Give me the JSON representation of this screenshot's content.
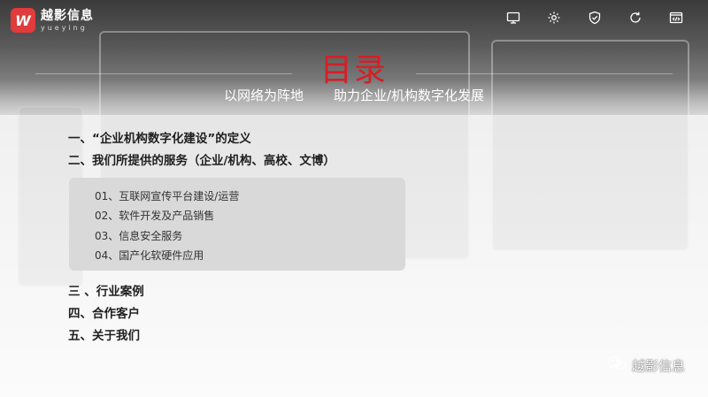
{
  "brand": {
    "logo_mark": "W",
    "name_cn": "越影信息",
    "name_en": "yueying"
  },
  "top_icons": [
    "monitor-icon",
    "settings-icon",
    "shield-icon",
    "refresh-icon",
    "code-icon"
  ],
  "header": {
    "title": "目录",
    "subtitle_left": "以网络为阵地",
    "subtitle_right": "助力企业/机构数字化发展"
  },
  "toc": {
    "items": [
      "一、“企业机构数字化建设”的定义",
      "二、我们所提供的服务（企业/机构、高校、文博）",
      "三 、行业案例",
      "四、合作客户",
      "五、关于我们"
    ],
    "sub_items": [
      "01、互联网宣传平台建设/运营",
      "02、软件开发及产品销售",
      "03、信息安全服务",
      "04、国产化软硬件应用"
    ]
  },
  "watermark": {
    "text": "越影信息"
  },
  "colors": {
    "title_red": "#d51f26",
    "logo_red": "#e23b3b"
  }
}
